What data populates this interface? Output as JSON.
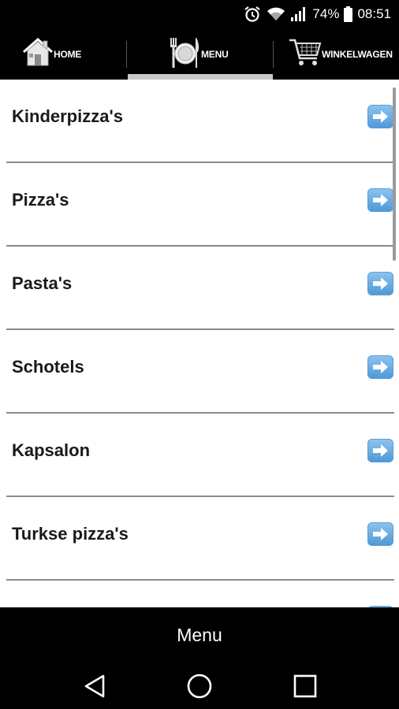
{
  "status_bar": {
    "battery": "74%",
    "time": "08:51",
    "icons": [
      "alarm-icon",
      "wifi-icon",
      "signal-icon",
      "battery-icon"
    ]
  },
  "top_nav": {
    "tabs": [
      {
        "label": "HOME",
        "icon": "house-icon",
        "selected": false
      },
      {
        "label": "MENU",
        "icon": "plate-cutlery-icon",
        "selected": true
      },
      {
        "label": "WINKELWAGEN",
        "icon": "shopping-cart-icon",
        "selected": false
      }
    ]
  },
  "menu_list": {
    "items": [
      {
        "label": "Kinderpizza's"
      },
      {
        "label": "Pizza's"
      },
      {
        "label": "Pasta's"
      },
      {
        "label": "Schotels"
      },
      {
        "label": "Kapsalon"
      },
      {
        "label": "Turkse pizza's"
      }
    ],
    "arrow_icon": "arrow-right-icon"
  },
  "bottom_bar": {
    "title": "Menu"
  },
  "android_nav": {
    "icons": [
      "back-icon",
      "home-circle-icon",
      "recents-icon"
    ]
  },
  "colors": {
    "bar_bg": "#000000",
    "list_bg": "#ffffff",
    "arrow_blue": "#4c98d8",
    "tab_indicator": "#c9c9c9"
  }
}
